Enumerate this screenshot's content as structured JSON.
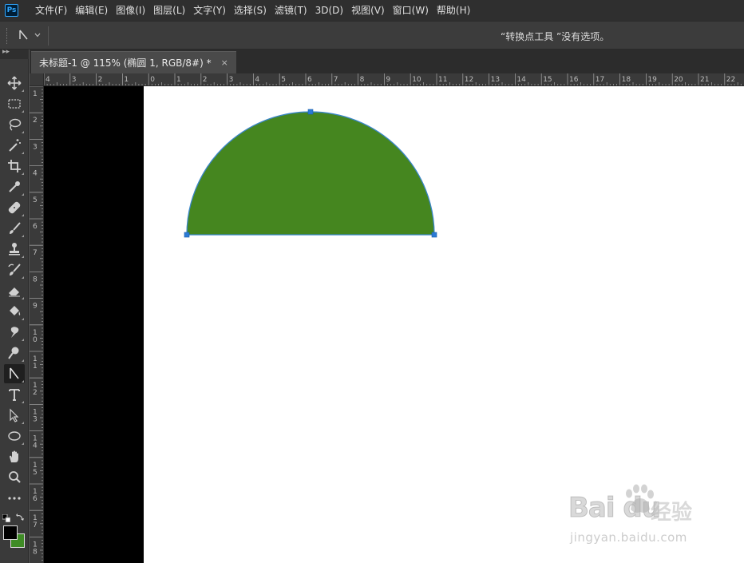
{
  "app": {
    "logo": "Ps"
  },
  "menubar": {
    "items": [
      "文件(F)",
      "编辑(E)",
      "图像(I)",
      "图层(L)",
      "文字(Y)",
      "选择(S)",
      "滤镜(T)",
      "3D(D)",
      "视图(V)",
      "窗口(W)",
      "帮助(H)"
    ]
  },
  "options_bar": {
    "tool_icon": "convert-point-icon",
    "message": "“转换点工具 ”没有选项。"
  },
  "toolbar": {
    "collapse_label": "▸▸",
    "tools": [
      {
        "name": "move-tool",
        "icon": "move-icon"
      },
      {
        "name": "marquee-tool",
        "icon": "marquee-icon"
      },
      {
        "name": "lasso-tool",
        "icon": "lasso-icon"
      },
      {
        "name": "magic-wand-tool",
        "icon": "magic-wand-icon"
      },
      {
        "name": "crop-tool",
        "icon": "crop-icon"
      },
      {
        "name": "eyedropper-tool",
        "icon": "eyedropper-icon"
      },
      {
        "name": "healing-brush-tool",
        "icon": "bandage-icon"
      },
      {
        "name": "brush-tool",
        "icon": "brush-icon"
      },
      {
        "name": "clone-stamp-tool",
        "icon": "stamp-icon"
      },
      {
        "name": "history-brush-tool",
        "icon": "history-brush-icon"
      },
      {
        "name": "eraser-tool",
        "icon": "eraser-icon"
      },
      {
        "name": "paint-bucket-tool",
        "icon": "paint-bucket-icon"
      },
      {
        "name": "smudge-tool",
        "icon": "smudge-icon"
      },
      {
        "name": "dodge-tool",
        "icon": "dodge-icon"
      },
      {
        "name": "convert-point-tool",
        "icon": "convert-point-icon",
        "active": true
      },
      {
        "name": "type-tool",
        "icon": "type-icon"
      },
      {
        "name": "path-selection-tool",
        "icon": "path-selection-icon"
      },
      {
        "name": "ellipse-tool",
        "icon": "ellipse-icon"
      },
      {
        "name": "hand-tool",
        "icon": "hand-icon"
      },
      {
        "name": "zoom-tool",
        "icon": "zoom-icon"
      },
      {
        "name": "more-tools",
        "icon": "more-icon"
      }
    ],
    "foreground_color": "#000000",
    "background_color": "#3f8c26"
  },
  "document": {
    "tab_title": "未标题-1 @ 115% (椭圆 1, RGB/8#) *",
    "close_glyph": "×"
  },
  "rulers": {
    "horizontal_labels": [
      "4",
      "3",
      "2",
      "1",
      "0",
      "1",
      "2",
      "3",
      "4",
      "5",
      "6",
      "7",
      "8",
      "9",
      "10",
      "11",
      "12",
      "13",
      "14",
      "15",
      "16",
      "17",
      "18",
      "19",
      "20",
      "21",
      "22"
    ],
    "vertical_labels": [
      "1",
      "2",
      "3",
      "4",
      "5",
      "6",
      "7",
      "8",
      "9",
      "10",
      "11",
      "12",
      "13",
      "14",
      "15",
      "16",
      "17",
      "18"
    ]
  },
  "shape": {
    "name": "椭圆 1",
    "kind": "half-ellipse",
    "fill": "#45861f",
    "stroke": "#3a86c8",
    "anchor_color": "#2c7bd6"
  },
  "watermark": {
    "logo_text": "Bai  du",
    "logo_cn": "经验",
    "url": "jingyan.baidu.com"
  }
}
